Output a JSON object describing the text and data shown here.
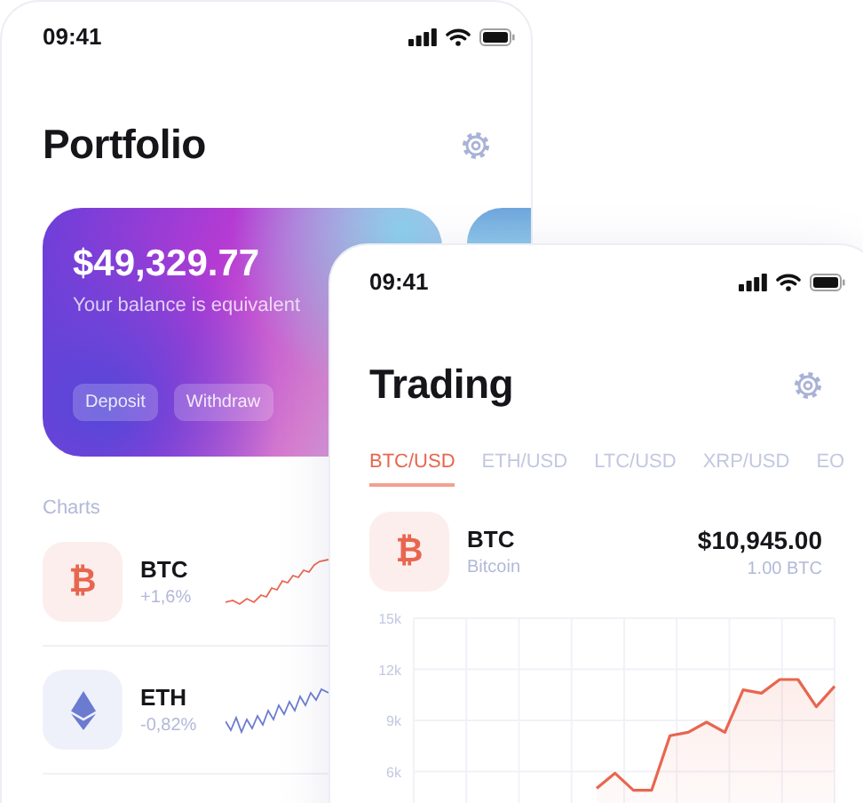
{
  "portfolio": {
    "status_time": "09:41",
    "title": "Portfolio",
    "balance": "$49,329.77",
    "balance_caption": "Your balance is equivalent",
    "actions": [
      "Deposit",
      "Withdraw"
    ],
    "section": "Charts",
    "coins": [
      {
        "kind": "glyph",
        "glyph": "₿",
        "name": "BTC",
        "change": "+1,6%",
        "color": "#e8664f"
      },
      {
        "kind": "diamond",
        "name": "ETH",
        "change": "-0,82%",
        "color": "#6b7bd0"
      }
    ]
  },
  "trading": {
    "status_time": "09:41",
    "title": "Trading",
    "tabs": [
      {
        "label": "BTC/USD",
        "selected": true
      },
      {
        "label": "ETH/USD",
        "selected": false
      },
      {
        "label": "LTC/USD",
        "selected": false
      },
      {
        "label": "XRP/USD",
        "selected": false
      },
      {
        "label": "EO",
        "selected": false
      }
    ],
    "asset": {
      "kind": "glyph",
      "glyph": "₿",
      "name": "BTC",
      "full_name": "Bitcoin",
      "price": "$10,945.00",
      "amount": "1.00 BTC",
      "color": "#e8664f"
    },
    "chart_data": {
      "type": "area",
      "categories": [
        null,
        null,
        null,
        null,
        null,
        null,
        null,
        null,
        null,
        null,
        null,
        null,
        null,
        null,
        null,
        null,
        null,
        null,
        null,
        null,
        null,
        null,
        null,
        null
      ],
      "series": [
        {
          "color": "#e8664f",
          "values": [
            null,
            null,
            null,
            null,
            null,
            null,
            null,
            null,
            null,
            null,
            5000,
            5900,
            4900,
            4900,
            8100,
            8300,
            8900,
            8300,
            10800,
            10600,
            11400,
            11400,
            9800,
            11000
          ]
        }
      ],
      "ylim": [
        3000,
        15000
      ],
      "grid": true,
      "yticks": [
        {
          "value": 15000,
          "label": "15k"
        },
        {
          "value": 12000,
          "label": "12k"
        },
        {
          "value": 9000,
          "label": "9k"
        },
        {
          "value": 6000,
          "label": "6k"
        }
      ]
    }
  }
}
